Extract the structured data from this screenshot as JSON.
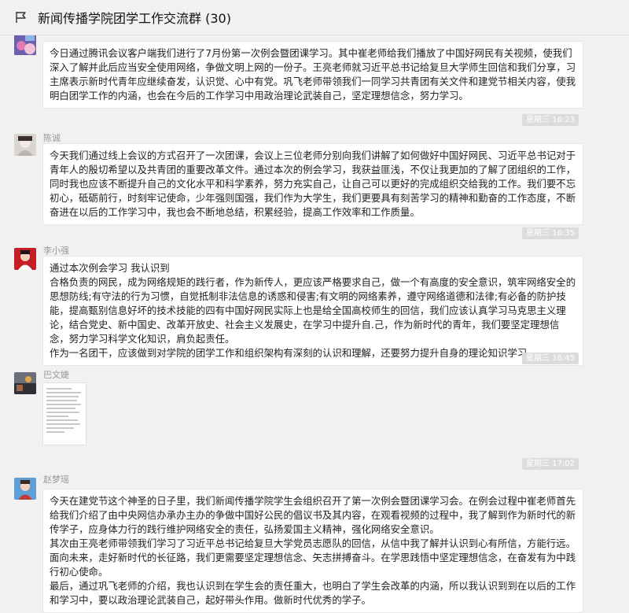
{
  "header": {
    "title": "新闻传播学院团学工作交流群 (30)"
  },
  "messages": [
    {
      "text": "今日通过腾讯会议客户端我们进行了7月份第一次例会暨团课学习。其中崔老师给我们播放了中国好网民有关视频，使我们深入了解并此后应当安全使用网络，争做文明上网的一份子。王亮老师就习近平总书记给复旦大学师生回信和我们分享，习主席表示新时代青年应继续奋发，认识觉、心中有党。巩飞老师带领我们一同学习共青团有关文件和建党节相关内容，使我明白团学工作的内涵，也会在今后的工作学习中用政治理论武装自己，坚定理想信念，努力学习。"
    },
    {
      "timestamp": "星期三 16:23",
      "sender": "陈诚",
      "text": "今天我们通过线上会议的方式召开了一次团课，会议上三位老师分别向我们讲解了如何做好中国好网民、习近平总书记对于青年人的殷切希望以及共青团的重要改革文件。通过本次的例会学习，我获益匪浅，不仅让我更加的了解了团组织的工作，同时我也应该不断提升自己的文化水平和科学素养，努力充实自己，让自己可以更好的完成组织交给我的工作。我们要不忘初心，砥砺前行，时刻牢记使命，少年强则国强，我们作为大学生，我们更要具有刻苦学习的精神和勤奋的工作态度，不断奋进在以后的工作学习中，我也会不断地总结，积累经验，提高工作效率和工作质量。"
    },
    {
      "timestamp": "星期三 16:35",
      "sender": "李小强",
      "text": "通过本次例会学习 我认识到\n合格负责的网民，成为网络规矩的践行者，作为新传人，更应该严格要求自己，做一个有高度的安全意识，筑牢网络安全的思想防线;有守法的行为习惯，自觉抵制非法信息的诱惑和侵害;有文明的网络素养，遵守网络道德和法律;有必备的防护技能，提高甄别信息好坏的技术技能的四有中国好网民实际上也是给全国高校师生的回信，我们应该认真学习马克思主义理论，结合党史、新中国史、改革开放史、社会主义发展史，在学习中提升自.己，作为新时代的青年，我们要坚定理想信念，努力学习科学文化知识，肩负起责任。\n作为一名团干，应该做到对学院的团学工作和组织架构有深刻的认识和理解，还要努力提升自身的理论知识学习。"
    },
    {
      "timestamp": "星期三 16:45",
      "sender": "巴文婕"
    },
    {
      "timestamp": "星期三 17:02",
      "sender": "赵梦瑶",
      "text": "今天在建党节这个神圣的日子里，我们新闻传播学院学生会组织召开了第一次例会暨团课学习会。在例会过程中崔老师首先给我们介绍了由中央网信办承办主办的争做中国好公民的倡议书及其内容，在观看视频的过程中，我了解到作为新时代的新传学子，应身体力行的践行维护网络安全的责任，弘扬爱国主义精神，强化网络安全意识。\n其次由王亮老师带领我们学习了习近平总书记给复旦大学党员志愿队的回信，从信中我了解并认识到心有所信，方能行远。面向未来，走好新时代的长征路，我们更需要坚定理想信念、矢志拼搏奋斗。在学思践悟中坚定理想信念，在奋发有为中践行初心使命。\n最后，通过巩飞老师的介绍，我也认识到在学生会的责任重大，也明白了学生会改革的内涵，所以我认识到到在以后的工作和学习中，要以政治理论武装自己，起好带头作用。做新时代优秀的学子。"
    }
  ]
}
